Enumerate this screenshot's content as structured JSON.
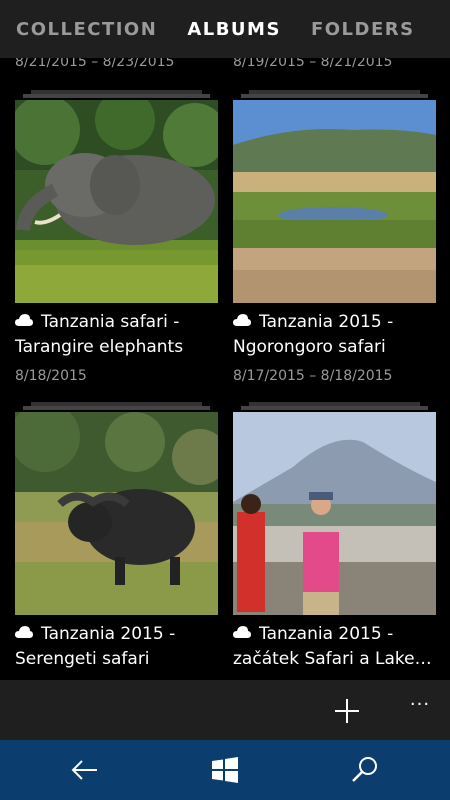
{
  "tabs": [
    "COLLECTION",
    "ALBUMS",
    "FOLDERS"
  ],
  "active_tab": "ALBUMS",
  "previous_row_dates": [
    "8/21/2015 – 8/23/2015",
    "8/19/2015 – 8/21/2015"
  ],
  "albums": [
    {
      "title_line1": "Tanzania safari -",
      "title_line2": "Tarangire elephants",
      "date": "8/18/2015",
      "cloud": "cloud-icon"
    },
    {
      "title_line1": "Tanzania 2015 -",
      "title_line2": "Ngorongoro safari",
      "date": "8/17/2015 – 8/18/2015",
      "cloud": "cloud-icon"
    },
    {
      "title_line1": "Tanzania 2015 -",
      "title_line2": "Serengeti safari",
      "date": "",
      "cloud": "cloud-icon"
    },
    {
      "title_line1": "Tanzania 2015 -",
      "title_line2": "začátek Safari a Lake…",
      "date": "",
      "cloud": "cloud-icon"
    }
  ],
  "app_bar": {
    "add_icon": "plus-icon",
    "more_label": "···"
  },
  "nav_bar": {
    "back_icon": "back-arrow-icon",
    "home_icon": "windows-logo-icon",
    "search_icon": "search-icon"
  },
  "colors": {
    "tab_bar": "#1f1f1f",
    "nav_bar": "#0b3d6e",
    "inactive_text": "#9a9a9a"
  }
}
